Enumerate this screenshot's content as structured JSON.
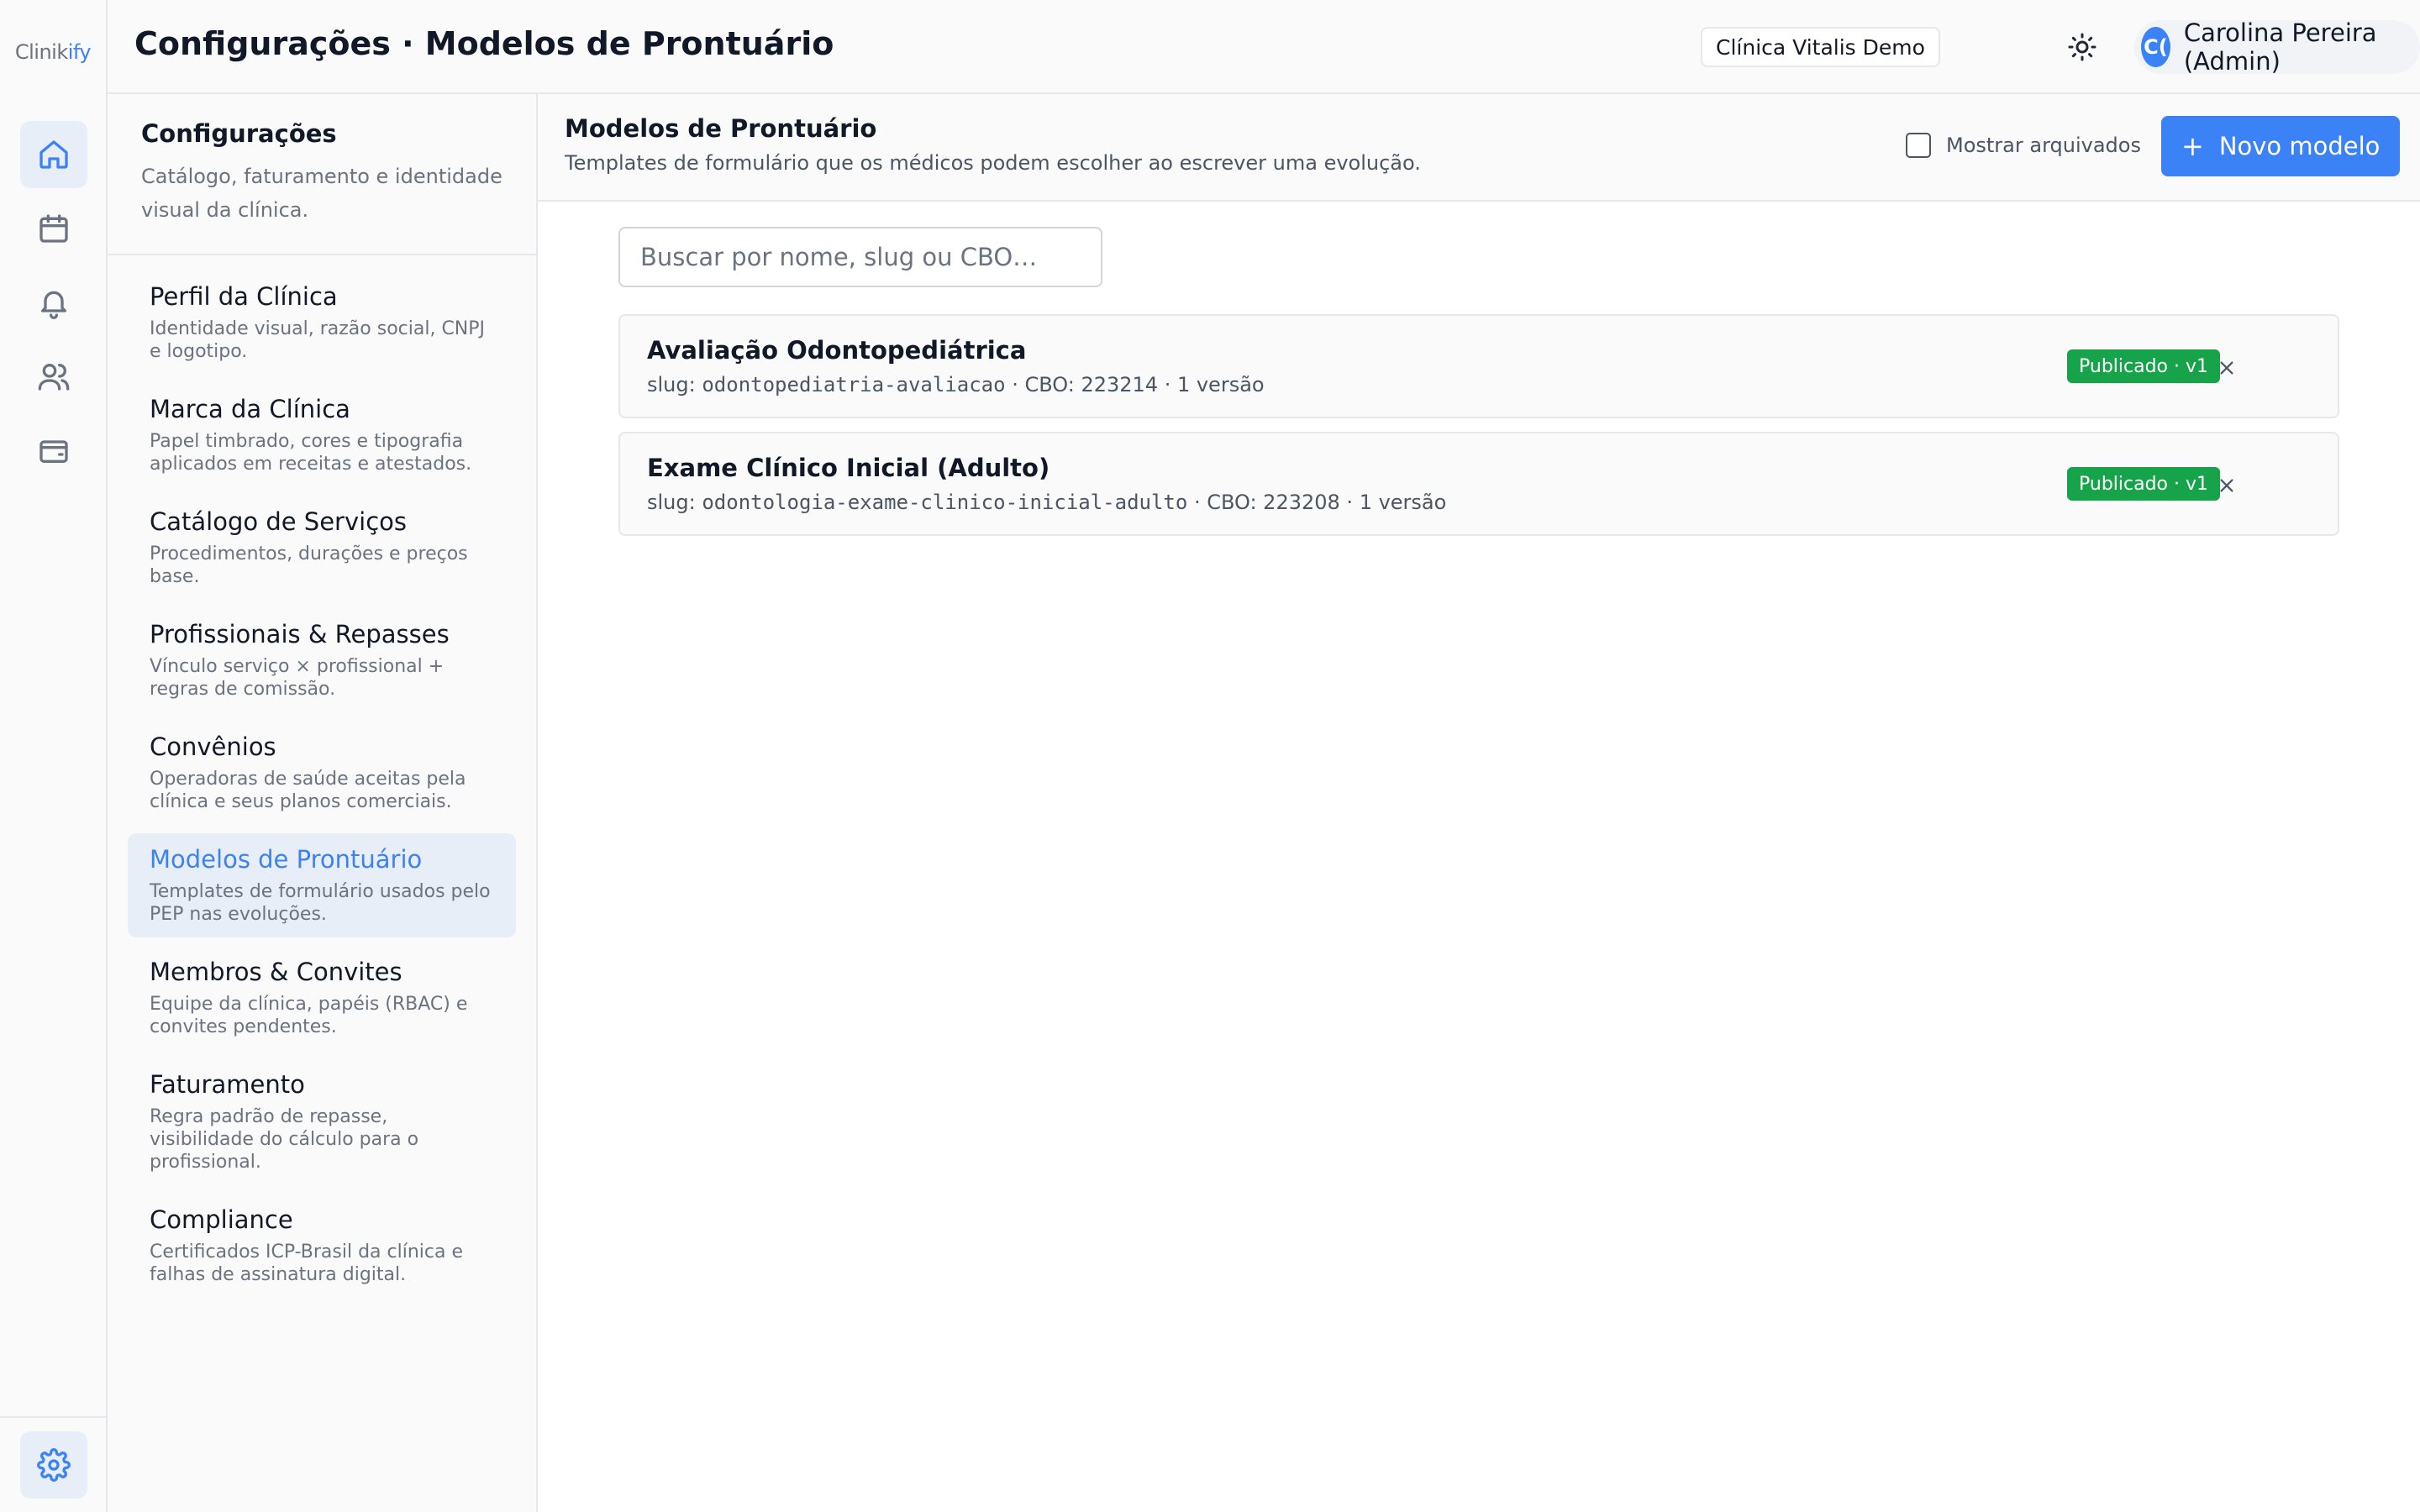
{
  "app": {
    "logo_prefix": "Clinik",
    "logo_accent": "ify"
  },
  "header": {
    "title": "Configurações · Modelos de Prontuário",
    "clinic": "Clínica Vitalis Demo",
    "user_initials": "C(",
    "user_name": "Carolina Pereira (Admin)"
  },
  "rail": {
    "items": [
      {
        "icon": "home-icon",
        "active": true
      },
      {
        "icon": "calendar-icon",
        "active": false
      },
      {
        "icon": "bell-icon",
        "active": false
      },
      {
        "icon": "users-icon",
        "active": false
      },
      {
        "icon": "wallet-icon",
        "active": false
      }
    ],
    "bottom_item": {
      "icon": "gear-icon",
      "active": true
    }
  },
  "settings_nav": {
    "title": "Configurações",
    "subtitle": "Catálogo, faturamento e identidade visual da clínica.",
    "items": [
      {
        "label": "Perfil da Clínica",
        "desc": "Identidade visual, razão social, CNPJ e logotipo."
      },
      {
        "label": "Marca da Clínica",
        "desc": "Papel timbrado, cores e tipografia aplicados em receitas e atestados."
      },
      {
        "label": "Catálogo de Serviços",
        "desc": "Procedimentos, durações e preços base."
      },
      {
        "label": "Profissionais & Repasses",
        "desc": "Vínculo serviço × profissional + regras de comissão."
      },
      {
        "label": "Convênios",
        "desc": "Operadoras de saúde aceitas pela clínica e seus planos comerciais."
      },
      {
        "label": "Modelos de Prontuário",
        "desc": "Templates de formulário usados pelo PEP nas evoluções."
      },
      {
        "label": "Membros & Convites",
        "desc": "Equipe da clínica, papéis (RBAC) e convites pendentes."
      },
      {
        "label": "Faturamento",
        "desc": "Regra padrão de repasse, visibilidade do cálculo para o profissional."
      },
      {
        "label": "Compliance",
        "desc": "Certificados ICP-Brasil da clínica e falhas de assinatura digital."
      }
    ],
    "active_index": 5
  },
  "main": {
    "title": "Modelos de Prontuário",
    "subtitle": "Templates de formulário que os médicos podem escolher ao escrever uma evolução.",
    "show_archived_label": "Mostrar arquivados",
    "show_archived_checked": false,
    "new_button_label": "Novo modelo",
    "search_placeholder": "Buscar por nome, slug ou CBO…",
    "templates": [
      {
        "name": "Avaliação Odontopediátrica",
        "slug_prefix": "slug: ",
        "slug": "odontopediatria-avaliacao",
        "meta_suffix": " · CBO: 223214 · 1 versão",
        "badge": "Publicado · v1"
      },
      {
        "name": "Exame Clínico Inicial (Adulto)",
        "slug_prefix": "slug: ",
        "slug": "odontologia-exame-clinico-inicial-adulto",
        "meta_suffix": " · CBO: 223208 · 1 versão",
        "badge": "Publicado · v1"
      }
    ]
  },
  "colors": {
    "accent": "#3b82f6",
    "success": "#16a34a",
    "active_bg": "#e8eef8"
  }
}
